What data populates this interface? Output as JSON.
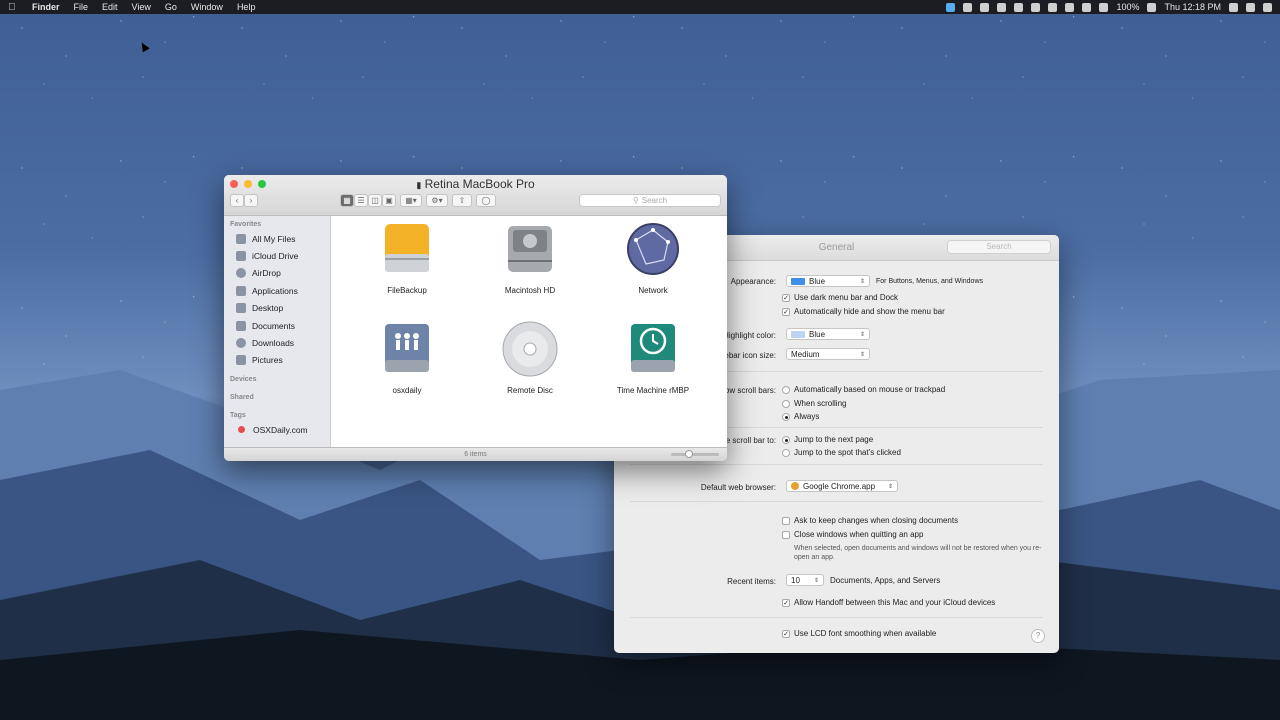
{
  "menubar": {
    "app": "Finder",
    "items": [
      "File",
      "Edit",
      "View",
      "Go",
      "Window",
      "Help"
    ],
    "battery": "100%",
    "clock": "Thu 12:18 PM"
  },
  "finder": {
    "title": "Retina MacBook Pro",
    "search_placeholder": "Search",
    "sidebar": {
      "favorites_header": "Favorites",
      "favorites": [
        "All My Files",
        "iCloud Drive",
        "AirDrop",
        "Applications",
        "Desktop",
        "Documents",
        "Downloads",
        "Pictures"
      ],
      "devices_header": "Devices",
      "shared_header": "Shared",
      "tags_header": "Tags",
      "tags": [
        "OSXDaily.com"
      ]
    },
    "items": [
      {
        "label": "FileBackup",
        "icon": "external-drive-icon"
      },
      {
        "label": "Macintosh HD",
        "icon": "internal-drive-icon"
      },
      {
        "label": "Network",
        "icon": "network-globe-icon"
      },
      {
        "label": "osxdaily",
        "icon": "network-drive-icon"
      },
      {
        "label": "Remote Disc",
        "icon": "disc-icon"
      },
      {
        "label": "Time Machine rMBP",
        "icon": "time-machine-icon"
      }
    ],
    "status": "6 items"
  },
  "prefs": {
    "title": "General",
    "search_placeholder": "Search",
    "appearance_label": "Appearance:",
    "appearance_value": "Blue",
    "appearance_note": "For Buttons, Menus, and Windows",
    "dark_menu": "Use dark menu bar and Dock",
    "auto_hide_menu": "Automatically hide and show the menu bar",
    "highlight_label": "Highlight color:",
    "highlight_value": "Blue",
    "sidebar_size_label": "Sidebar icon size:",
    "sidebar_size_value": "Medium",
    "scroll_bars_label": "Show scroll bars:",
    "scroll_bars_options": [
      "Automatically based on mouse or trackpad",
      "When scrolling",
      "Always"
    ],
    "click_label": "Click in the scroll bar to:",
    "click_options": [
      "Jump to the next page",
      "Jump to the spot that's clicked"
    ],
    "browser_label": "Default web browser:",
    "browser_value": "Google Chrome.app",
    "ask_keep": "Ask to keep changes when closing documents",
    "close_windows": "Close windows when quitting an app",
    "close_note": "When selected, open documents and windows will not be restored when you re-open an app.",
    "recent_label": "Recent items:",
    "recent_value": "10",
    "recent_note": "Documents, Apps, and Servers",
    "handoff": "Allow Handoff between this Mac and your iCloud devices",
    "lcd": "Use LCD font smoothing when available"
  },
  "colors": {
    "appearance_swatch": "#3f8ee8",
    "highlight_swatch": "#bcd4f2",
    "tag_red": "#e94c4c"
  }
}
